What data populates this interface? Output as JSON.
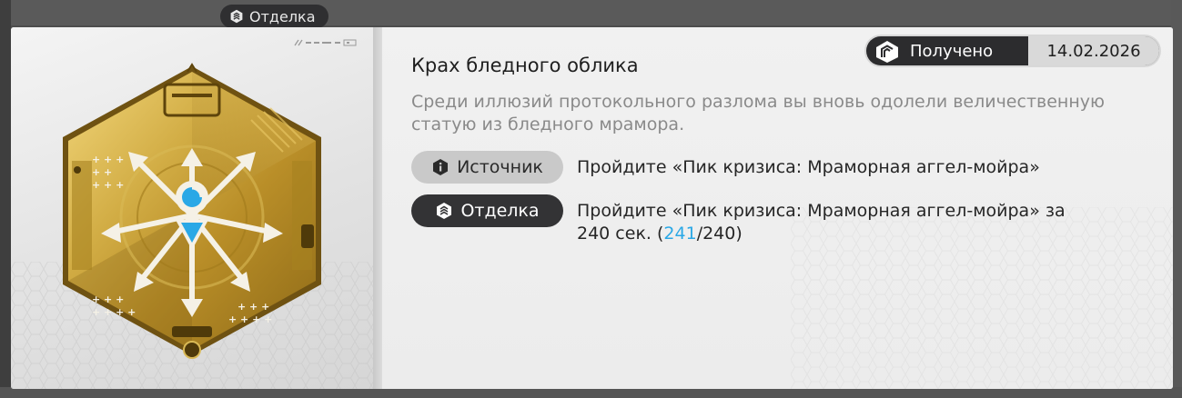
{
  "background": {
    "badge_label": "Отделка"
  },
  "achievement": {
    "title": "Крах бледного облика",
    "description": "Среди иллюзий протокольного разлома вы вновь одолели величественную статую из бледного мрамора.",
    "status_label": "Получено",
    "date": "14.02.2026",
    "source": {
      "label": "Источник",
      "icon": "info-icon",
      "text": "Пройдите «Пик кризиса: Мраморная аггел-мойра»"
    },
    "finish": {
      "label": "Отделка",
      "icon": "finish-badge-icon",
      "text_main": "Пройдите «Пик кризиса: Мраморная аггел-мойра» за 240 сек. (",
      "progress_current": "241",
      "progress_sep_total": "/240)"
    }
  },
  "colors": {
    "accent": "#2aa8e6",
    "gold": "#c9a437",
    "dark_pill": "#333335",
    "light_pill": "#c9c9c9"
  }
}
